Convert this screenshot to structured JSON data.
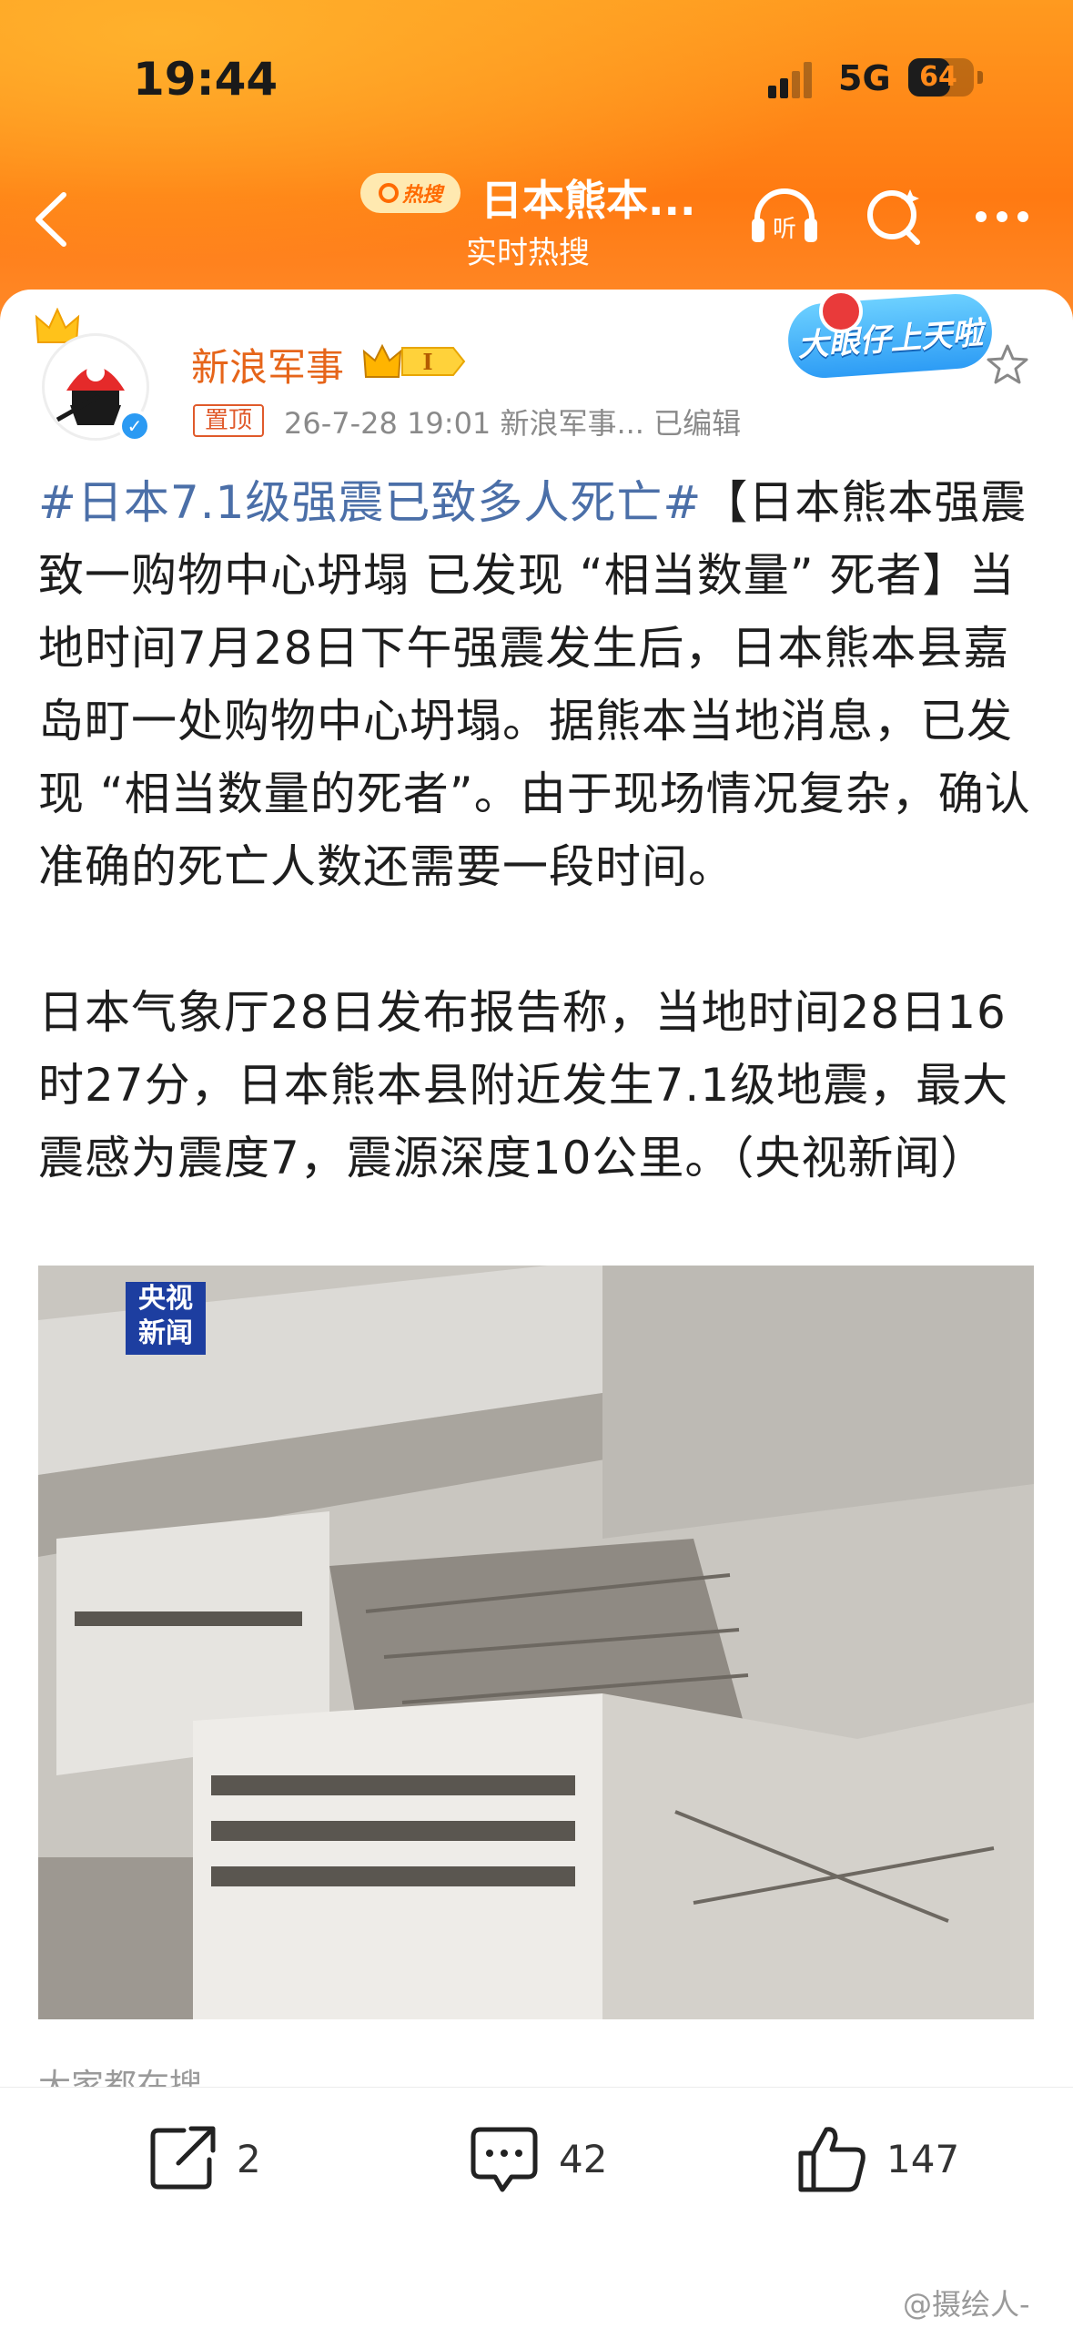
{
  "status_bar": {
    "time": "19:44",
    "network": "5G",
    "battery": "64",
    "battery_level": 0.64
  },
  "nav": {
    "hot_badge": "热搜",
    "title": "日本熊本...",
    "subtitle": "实时热搜",
    "icons": [
      "back-icon",
      "listen-icon",
      "search-icon",
      "more-icon"
    ]
  },
  "post": {
    "author": "新浪军事",
    "level": "I",
    "pinned_label": "置顶",
    "meta": "26-7-28 19:01  新浪军事...  已编辑",
    "sticker": "大眼仔上天啦",
    "hashtag": "#日本7.1级强震已致多人死亡#",
    "paragraph1_rest": "【日本熊本强震致一购物中心坍塌 已发现 “相当数量” 死者】当地时间7月28日下午强震发生后，日本熊本县嘉岛町一处购物中心坍塌。据熊本当地消息，已发现 “相当数量的死者”。由于现场情况复杂，确认准确的死亡人数还需要一段时间。",
    "paragraph2": "日本气象厅28日发布报告称，当地时间28日16时27分，日本熊本县附近发生7.1级地震，最大震感为震度7，震源深度10公里。（央视新闻）",
    "image_logo": "央视\n新闻",
    "search_hint": "大家都在搜"
  },
  "actions": {
    "repost_count": "2",
    "comment_count": "42",
    "like_count": "147"
  },
  "watermark": "@摄绘人-",
  "colors": {
    "header_orange": "#ff7a12",
    "author_orange": "#e6651a",
    "hashtag_blue": "#4b6fa8"
  }
}
